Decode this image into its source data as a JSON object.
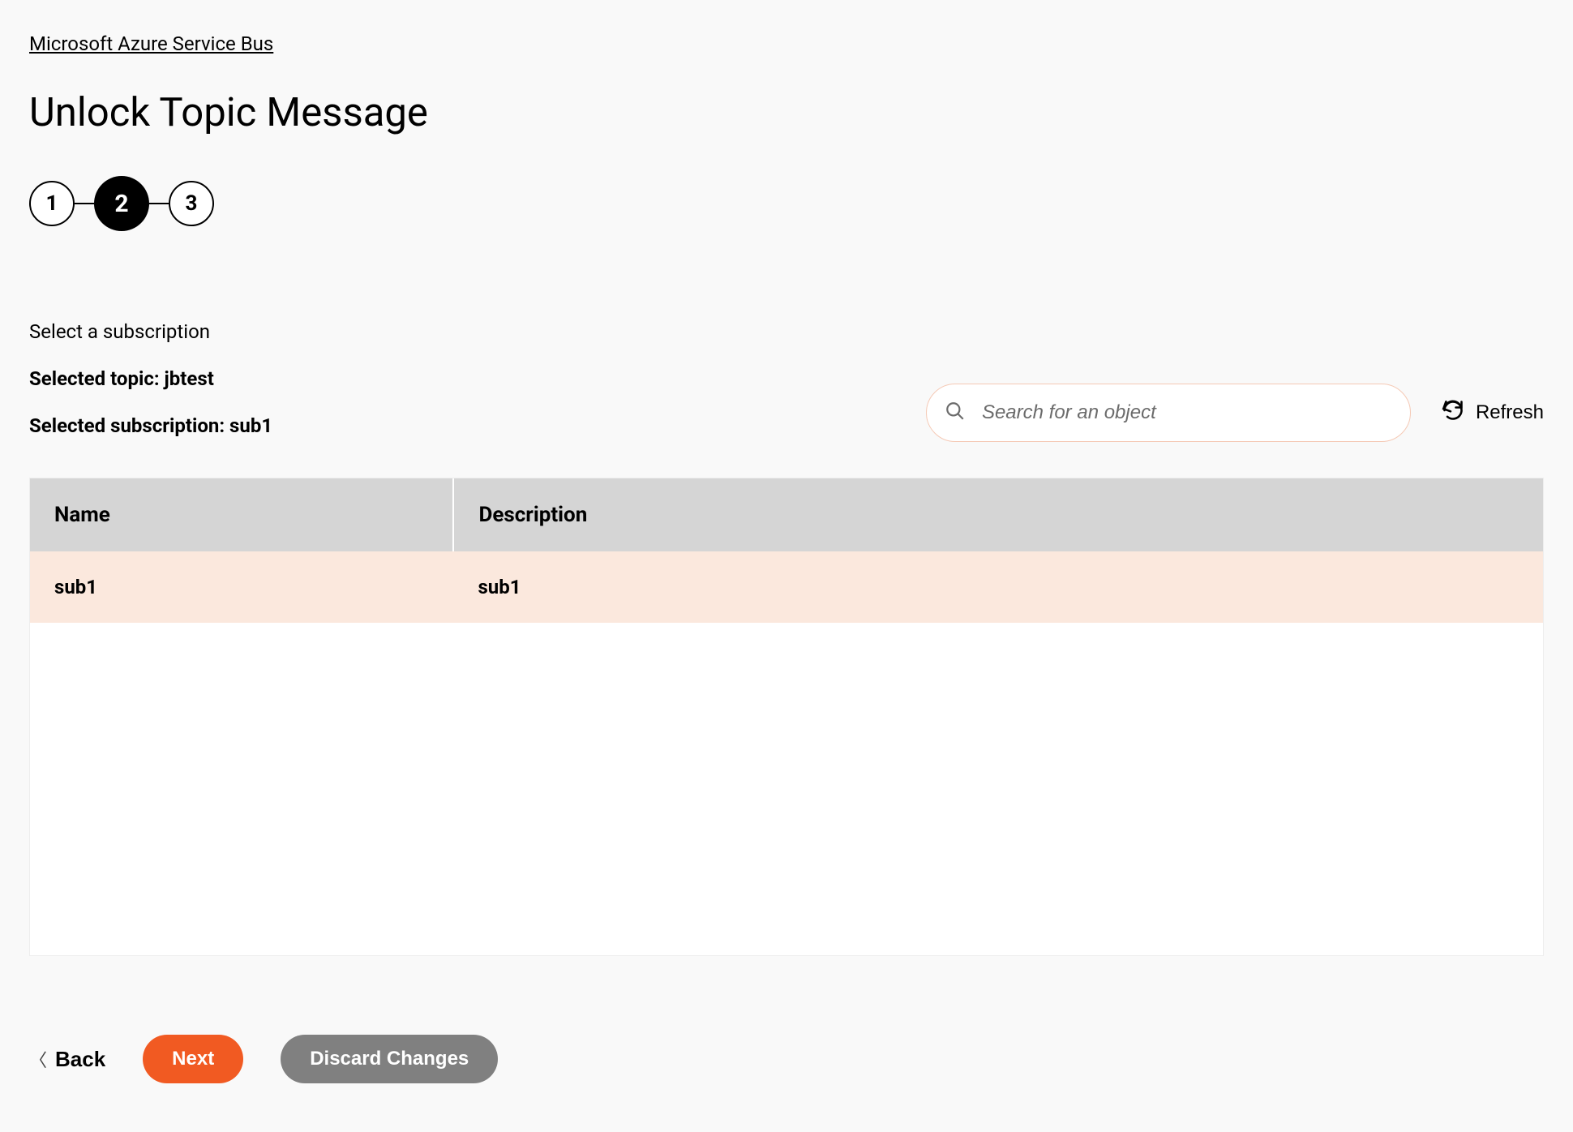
{
  "breadcrumb": "Microsoft Azure Service Bus",
  "page_title": "Unlock Topic Message",
  "stepper": {
    "steps": [
      "1",
      "2",
      "3"
    ],
    "active_index": 1
  },
  "instruction": "Select a subscription",
  "selected_topic_label": "Selected topic: jbtest",
  "selected_subscription_label": "Selected subscription: sub1",
  "search": {
    "placeholder": "Search for an object",
    "value": ""
  },
  "refresh_label": "Refresh",
  "table": {
    "headers": {
      "name": "Name",
      "description": "Description"
    },
    "rows": [
      {
        "name": "sub1",
        "description": "sub1",
        "selected": true
      }
    ]
  },
  "footer": {
    "back": "Back",
    "next": "Next",
    "discard": "Discard Changes"
  }
}
